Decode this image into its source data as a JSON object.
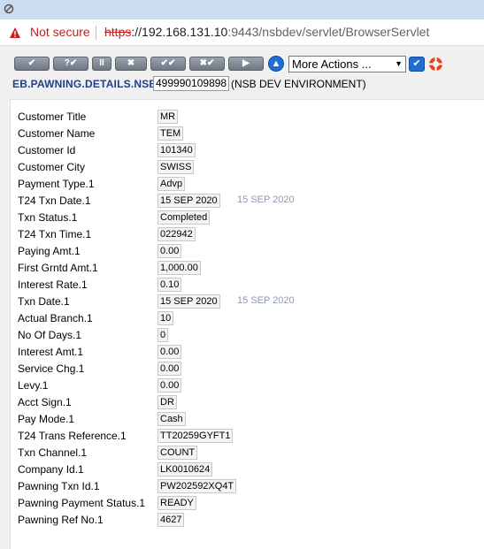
{
  "browser": {
    "app_icon": "app-icon",
    "security_label": "Not secure",
    "url_scheme": "https",
    "url_host": "://192.168.131.10",
    "url_rest": ":9443/nsbdev/servlet/BrowserServlet"
  },
  "toolbar": {
    "buttons": [
      {
        "name": "commit-button",
        "label": "✔"
      },
      {
        "name": "validate-button",
        "label": "?✔"
      },
      {
        "name": "hold-button",
        "label": "II"
      },
      {
        "name": "delete-button",
        "label": "✖"
      },
      {
        "name": "authorise-button",
        "label": "✔✔"
      },
      {
        "name": "reverse-button",
        "label": "✖✔"
      },
      {
        "name": "next-button",
        "label": "▶"
      }
    ],
    "nav_up_icon": "up-arrow-icon",
    "more_actions": "More Actions ...",
    "go_icon": "check-icon",
    "help_icon": "lifebuoy-icon"
  },
  "header": {
    "app_name": "EB.PAWNING.DETAILS.NSB",
    "record_id": "499990109898",
    "environment": "(NSB DEV ENVIRONMENT)"
  },
  "fields": [
    {
      "label": "Customer Title",
      "value": "MR",
      "extra": ""
    },
    {
      "label": "Customer Name",
      "value": "TEM",
      "extra": ""
    },
    {
      "label": "Customer Id",
      "value": "101340",
      "extra": ""
    },
    {
      "label": "Customer City",
      "value": "SWISS",
      "extra": ""
    },
    {
      "label": "Payment Type.1",
      "value": "Advp",
      "extra": ""
    },
    {
      "label": "T24 Txn Date.1",
      "value": "15 SEP 2020",
      "extra": "15 SEP 2020"
    },
    {
      "label": "Txn Status.1",
      "value": "Completed",
      "extra": ""
    },
    {
      "label": "T24 Txn Time.1",
      "value": "022942",
      "extra": ""
    },
    {
      "label": "Paying Amt.1",
      "value": "0.00",
      "extra": ""
    },
    {
      "label": "First Grntd Amt.1",
      "value": "1,000.00",
      "extra": ""
    },
    {
      "label": "Interest Rate.1",
      "value": "0.10",
      "extra": ""
    },
    {
      "label": "Txn Date.1",
      "value": "15 SEP 2020",
      "extra": "15 SEP 2020"
    },
    {
      "label": "Actual Branch.1",
      "value": "10",
      "extra": ""
    },
    {
      "label": "No Of Days.1",
      "value": "0",
      "extra": ""
    },
    {
      "label": "Interest Amt.1",
      "value": "0.00",
      "extra": ""
    },
    {
      "label": "Service Chg.1",
      "value": "0.00",
      "extra": ""
    },
    {
      "label": "Levy.1",
      "value": "0.00",
      "extra": ""
    },
    {
      "label": "Acct Sign.1",
      "value": "DR",
      "extra": ""
    },
    {
      "label": "Pay Mode.1",
      "value": "Cash",
      "extra": ""
    },
    {
      "label": "T24 Trans Reference.1",
      "value": "TT20259GYFT1",
      "extra": ""
    },
    {
      "label": "Txn Channel.1",
      "value": "COUNT",
      "extra": ""
    },
    {
      "label": "Company Id.1",
      "value": "LK0010624",
      "extra": ""
    },
    {
      "label": "Pawning Txn Id.1",
      "value": "PW202592XQ4T",
      "extra": ""
    },
    {
      "label": "Pawning Payment Status.1",
      "value": "READY",
      "extra": ""
    },
    {
      "label": "Pawning Ref No.1",
      "value": "4627",
      "extra": ""
    }
  ]
}
